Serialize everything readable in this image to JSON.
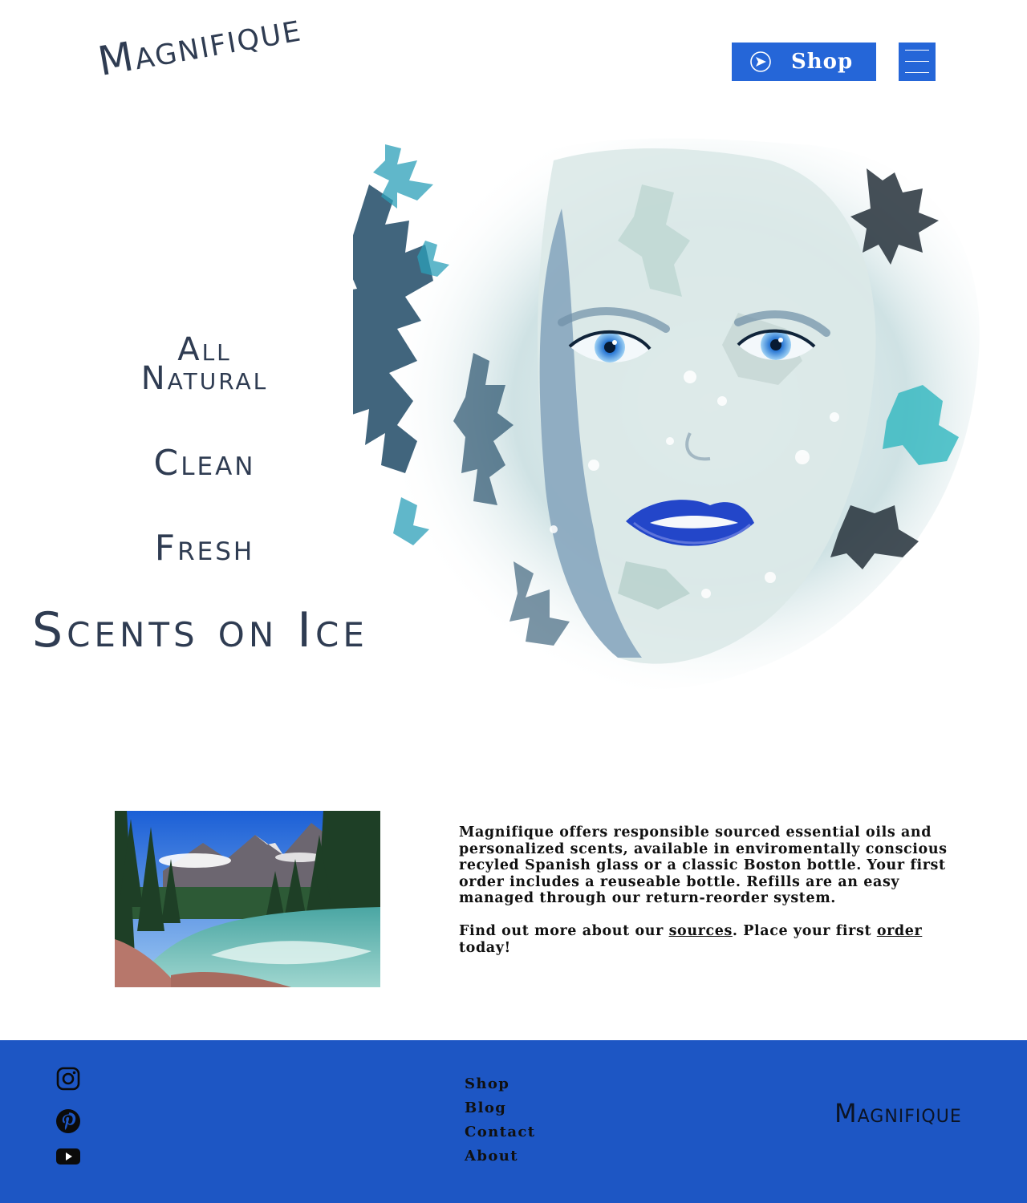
{
  "header": {
    "logo": "Magnifique",
    "shop_button": {
      "label": "Shop",
      "icon": "arrow-circle-icon"
    },
    "menu_button": {
      "icon": "hamburger-menu-icon"
    }
  },
  "hero": {
    "taglines": [
      "All",
      "Natural",
      "Clean",
      "Fresh"
    ],
    "headline": "Scents on Ice",
    "image": "watercolor-face-with-frost"
  },
  "about": {
    "image": "mountain-river-photo",
    "paragraph": "Magnifique offers responsible sourced essential oils and personalized scents, available in enviromentally conscious recyled Spanish glass or a classic Boston bottle. Your first order includes a reuseable bottle.  Refills are an easy managed through our return-reorder system.",
    "cta": {
      "prefix": "Find out more about our ",
      "sources_link": "sources",
      "middle": ". Place your first ",
      "order_link": "order",
      "suffix": " today!"
    }
  },
  "footer": {
    "social": [
      {
        "icon": "instagram-icon"
      },
      {
        "icon": "pinterest-icon"
      },
      {
        "icon": "youtube-icon"
      }
    ],
    "nav": [
      "Shop",
      "Blog",
      "Contact",
      "About"
    ],
    "logo": "Magnifique"
  },
  "colors": {
    "brand_blue": "#2566d8",
    "footer_blue": "#1d56c4",
    "heading_ink": "#2f3c52"
  }
}
